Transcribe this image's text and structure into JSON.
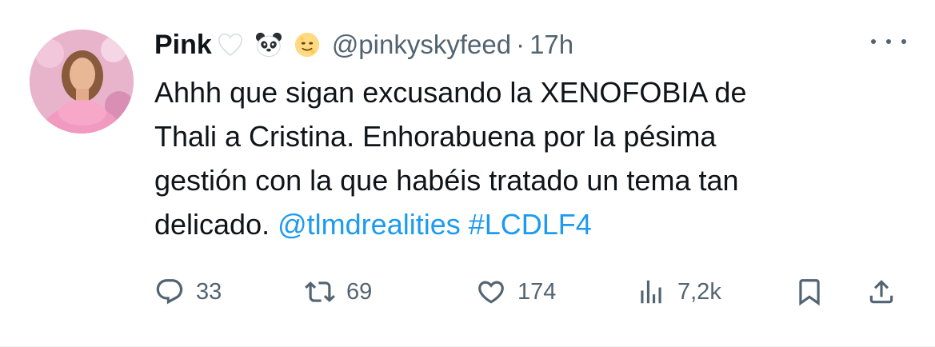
{
  "tweet": {
    "display_name": "Pink",
    "name_emojis": [
      "white-heart-icon",
      "panda-face-icon",
      "full-moon-face-icon"
    ],
    "handle": "@pinkyskyfeed",
    "separator": "·",
    "time": "17h",
    "text_lines": [
      "Ahhh que sigan excusando la XENOFOBIA de",
      "Thali a Cristina. Enhorabuena por la pésima",
      "gestión con la que habéis tratado un tema tan"
    ],
    "last_line_text": "delicado.",
    "mention": "@tlmdrealities",
    "hashtag": "#LCDLF4",
    "link_color": "#1d9bf0"
  },
  "actions": {
    "replies": "33",
    "retweets": "69",
    "likes": "174",
    "views": "7,2k"
  },
  "icons": {
    "more": "more-options-icon",
    "reply": "reply-icon",
    "retweet": "retweet-icon",
    "like": "heart-icon",
    "views": "views-icon",
    "bookmark": "bookmark-icon",
    "share": "share-icon"
  }
}
